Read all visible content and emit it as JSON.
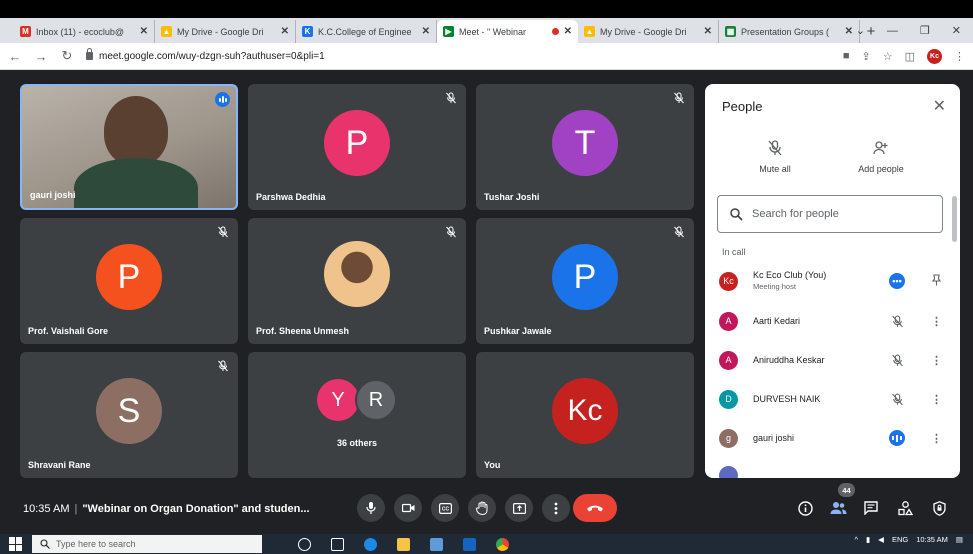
{
  "browser": {
    "tabs": [
      {
        "title": "Inbox (11) - ecoclub@",
        "icon": "gmail-icon",
        "color": "#d93025",
        "glyph": "M",
        "active": false
      },
      {
        "title": "My Drive - Google Dri",
        "icon": "google-drive-icon",
        "color": "#fbbc04",
        "glyph": "▲",
        "active": false
      },
      {
        "title": "K.C.College of Enginee",
        "icon": "college-site-icon",
        "color": "#1a73e8",
        "glyph": "K",
        "active": false
      },
      {
        "title": "Meet - \" Webinar",
        "icon": "google-meet-icon",
        "color": "#00832d",
        "glyph": "▶",
        "active": true
      },
      {
        "title": "My Drive - Google Dri",
        "icon": "google-drive-icon",
        "color": "#fbbc04",
        "glyph": "▲",
        "active": false
      },
      {
        "title": "Presentation Groups (",
        "icon": "google-sheets-icon",
        "color": "#188038",
        "glyph": "▦",
        "active": false
      }
    ],
    "url": "meet.google.com/wuy-dzgn-suh?authuser=0&pli=1",
    "profile_initials": "Kc"
  },
  "meet": {
    "tiles": [
      {
        "name": "gauri joshi",
        "type": "video",
        "speaking": true
      },
      {
        "name": "Parshwa Dedhia",
        "initial": "P",
        "color": "#e8336d",
        "muted": true
      },
      {
        "name": "Tushar Joshi",
        "initial": "T",
        "color": "#a142c5",
        "muted": true
      },
      {
        "name": "Prof. Vaishali Gore",
        "initial": "P",
        "color": "#f4511e",
        "muted": true
      },
      {
        "name": "Prof. Sheena Unmesh",
        "type": "photo",
        "muted": true
      },
      {
        "name": "Pushkar Jawale",
        "initial": "P",
        "color": "#1a73e8",
        "muted": true
      },
      {
        "name": "Shravani Rane",
        "initial": "S",
        "color": "#8d6e63",
        "muted": true
      },
      {
        "name": "36 others",
        "type": "group",
        "initials": [
          "Y",
          "R"
        ],
        "colors": [
          "#e8336d",
          "#5f6368"
        ]
      },
      {
        "name": "You",
        "initial": "Kc",
        "color": "#c5221f"
      }
    ],
    "meeting_time": "10:35 AM",
    "meeting_title": "\"Webinar on Organ Donation\" and studen...",
    "participants_count": "44"
  },
  "people_panel": {
    "title": "People",
    "mute_all": "Mute all",
    "add_people": "Add people",
    "search_placeholder": "Search for people",
    "section_label": "In call",
    "participants": [
      {
        "name": "Kc Eco Club (You)",
        "role": "Meeting host",
        "initial": "Kc",
        "color": "#c5221f",
        "action": "more-options-icon",
        "pin": true
      },
      {
        "name": "Aarti Kedari",
        "initial": "A",
        "color": "#c2185b",
        "action": "mic-off-icon"
      },
      {
        "name": "Aniruddha Keskar",
        "initial": "A",
        "color": "#c2185b",
        "action": "mic-off-icon"
      },
      {
        "name": "DURVESH NAIK",
        "initial": "D",
        "color": "#0097a7",
        "action": "mic-off-icon"
      },
      {
        "name": "gauri joshi",
        "initial": "g",
        "color": "#8d6e63",
        "action": "speaking-icon"
      }
    ]
  },
  "taskbar": {
    "search_placeholder": "Type here to search",
    "lang": "ENG",
    "time": "10:35 AM"
  }
}
